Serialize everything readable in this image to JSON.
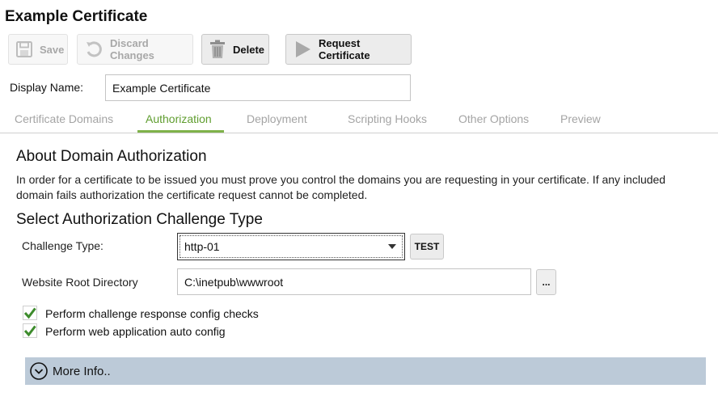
{
  "title": "Example Certificate",
  "toolbar": {
    "save_label": "Save",
    "discard_label": "Discard Changes",
    "delete_label": "Delete",
    "request_label": "Request Certificate"
  },
  "display_name": {
    "label": "Display Name:",
    "value": "Example Certificate"
  },
  "tabs": [
    {
      "label": "Certificate Domains",
      "active": false
    },
    {
      "label": "Authorization",
      "active": true
    },
    {
      "label": "Deployment",
      "active": false
    },
    {
      "label": "Scripting Hooks",
      "active": false
    },
    {
      "label": "Other Options",
      "active": false
    },
    {
      "label": "Preview",
      "active": false
    }
  ],
  "about": {
    "heading": "About Domain Authorization",
    "text": "In order for a certificate to be issued you must prove you control the domains you are requesting in your certificate. If any included domain fails authorization the certificate request cannot be completed."
  },
  "challenge": {
    "heading": "Select Authorization Challenge Type",
    "type_label": "Challenge Type:",
    "type_value": "http-01",
    "test_label": "TEST",
    "root_label": "Website Root Directory",
    "root_value": "C:\\inetpub\\wwwroot",
    "browse_label": "..."
  },
  "checks": [
    {
      "label": "Perform challenge response config checks",
      "checked": true
    },
    {
      "label": "Perform web application auto config",
      "checked": true
    }
  ],
  "more_info": {
    "label": "More Info.."
  },
  "colors": {
    "accent": "#5f9d2f",
    "check": "#3d8b2c",
    "more_bar": "#bccad8"
  }
}
